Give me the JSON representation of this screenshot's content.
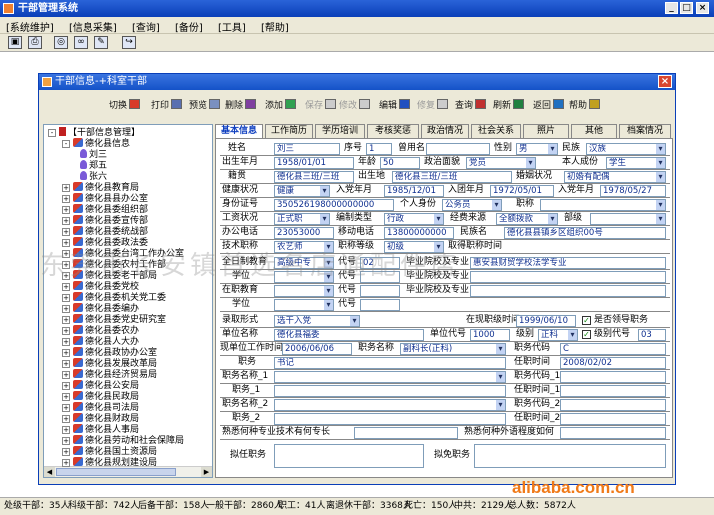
{
  "app": {
    "title": "干部管理系统"
  },
  "menu": [
    "[系统维护]",
    "[信息采集]",
    "[查询]",
    "[备份]",
    "[工具]",
    "[帮助]"
  ],
  "dialog": {
    "title": "干部信息-+科室干部",
    "actions": [
      {
        "label": "切换",
        "icon": "arrow-right-icon",
        "disabled": false
      },
      {
        "label": "打印",
        "icon": "printer-icon",
        "disabled": false
      },
      {
        "label": "预览",
        "icon": "preview-icon",
        "disabled": false
      },
      {
        "label": "删除",
        "icon": "delete-icon",
        "disabled": false
      },
      {
        "label": "添加",
        "icon": "add-icon",
        "disabled": false
      },
      {
        "label": "保存",
        "icon": "save-icon",
        "disabled": true
      },
      {
        "label": "修改",
        "icon": "modify-icon",
        "disabled": true
      },
      {
        "label": "编辑",
        "icon": "edit-icon",
        "disabled": false
      },
      {
        "label": "修复",
        "icon": "repair-icon",
        "disabled": true
      },
      {
        "label": "查询",
        "icon": "search-icon",
        "disabled": false
      },
      {
        "label": "刷新",
        "icon": "refresh-icon",
        "disabled": false
      },
      {
        "label": "返回",
        "icon": "return-icon",
        "disabled": false
      },
      {
        "label": "帮助",
        "icon": "help-icon",
        "disabled": false
      }
    ]
  },
  "tree": {
    "root": "【干部信息管理】",
    "expanded": "德化县信息",
    "people": [
      "刘三",
      "郑五",
      "张六"
    ],
    "groups": [
      "德化县教育局",
      "德化县县办公室",
      "德化县委组织部",
      "德化县委宣传部",
      "德化县委统战部",
      "德化县委政法委",
      "德化县委台湾工作办公室",
      "德化县委农村工作部",
      "德化县委老干部局",
      "德化县委党校",
      "德化县委机关党工委",
      "德化县委编办",
      "德化县委党史研究室",
      "德化县委农办",
      "德化县人大办",
      "德化县政协办公室",
      "德化县发展改革局",
      "德化县经济贸易局",
      "德化县公安局",
      "德化县民政局",
      "德化县司法局",
      "德化县财政局",
      "德化县人事局",
      "德化县劳动和社会保障局",
      "德化县国土资源局",
      "德化县规划建设局",
      "德化县交通局"
    ]
  },
  "tabs": [
    "基本信息",
    "工作简历",
    "学历培训",
    "考核奖惩",
    "政治情况",
    "社会关系",
    "照片",
    "其他",
    "档案情况"
  ],
  "form": {
    "name_label": "姓名",
    "name": "刘三",
    "seq_label": "序号",
    "seq": "1",
    "alias_label": "曾用名",
    "alias": "",
    "gender_label": "性别",
    "gender": "男",
    "ethnic_label": "民族",
    "ethnic": "汉族",
    "birth_label": "出生年月",
    "birth": "1958/01/01",
    "age_label": "年龄",
    "age": "50",
    "political_label": "政治面貌",
    "political": "党员",
    "identity_label": "本人成份",
    "identity": "学生",
    "native_label": "籍贯",
    "native": "德化县三班/三班",
    "birthplace_label": "出生地",
    "birthplace": "德化县三班/三班",
    "marital_label": "婚姻状况",
    "marital": "初婚有配偶",
    "health_label": "健康状况",
    "health": "健康",
    "party_date_label": "入党年月",
    "party_date": "1985/12/01",
    "work_date_label": "入团年月",
    "work_date": "1972/05/01",
    "join_date_label": "入党年月",
    "join_date": "1978/05/27",
    "idcard_label": "身份证号",
    "idcard": "350526198000000000",
    "status_label": "个人身份",
    "status": "公务员",
    "title_label": "职称",
    "title": "",
    "worktype_label": "工资状况",
    "worktype": "正式职",
    "salary_label": "编制类型",
    "salary": "行政",
    "treatment_label": "经费来源",
    "treatment": "全额拨款",
    "dept_label": "部级",
    "dept": "",
    "office_phone_label": "办公电话",
    "office_phone": "23053000",
    "mobile_label": "移动电话",
    "mobile": "13800000000",
    "email_label": "民族名",
    "email": "德化县县镇乡区组织00号",
    "tech_label": "技术职称",
    "tech": "农艺师",
    "tech_level_label": "职称等级",
    "tech_level": "初级",
    "tech_date_label": "取得职称时间",
    "fulltime_label": "全日制教育",
    "fulltime": "高级中专",
    "code_label": "代号",
    "code": "02",
    "school_label": "毕业院校及专业",
    "school": "惠安县财贸学校法学专业",
    "onjob_label": "在职教育",
    "degree_label": "学位",
    "onjob_degree_label": "学位",
    "school2_label": "毕业院校及专业",
    "school3_label": "毕业院校及专业",
    "code2_label": "代号",
    "code3_label": "代号",
    "code4_label": "代号",
    "appoint_method_label": "录取形式",
    "appoint_method": "选干入党",
    "appoint_date_label": "在现职级时间",
    "appoint_date": "1999/06/10",
    "fullmark_label": "是否领导职务",
    "unit_label": "单位名称",
    "unit": "德化县福委",
    "unit_code_label": "单位代号",
    "unit_code": "1000",
    "rank_label": "级别",
    "rank": "正科",
    "rank_code_label": "级别代号",
    "rank_code": "03",
    "current_date_label": "现单位工作时间",
    "current_date": "2006/06/06",
    "post_name_label": "职务名称",
    "post_name": "副科长(正科)",
    "post_code_label": "职务代码",
    "post_code": "C",
    "duty_label": "职务",
    "duty": "书记",
    "duty_date_label": "任职时间",
    "duty_date": "2008/02/02",
    "post2_label": "职务名称_1",
    "post2_code_label": "职务代码_1",
    "duty2_label": "职务_1",
    "duty2_date_label": "任职时间_1",
    "post3_label": "职务名称_2",
    "post3_code_label": "职务代码_2",
    "duty3_label": "职务_2",
    "duty3_date_label": "任职时间_2",
    "specialty_label": "熟悉何种专业技术有何专长",
    "language_label": "熟悉何种外语程度如何",
    "appoint_label": "拟任职务",
    "remove_label": "拟免职务"
  },
  "status": [
    "处级干部：35人",
    "科级干部：742人",
    "后备干部：158人",
    "一般干部：2860人",
    "职工：41人",
    "离退休干部：3368人",
    "死亡：150人",
    "中共：2129人",
    "总人数：5872人"
  ],
  "watermark": "东莞市长安镇首选名店通配件店",
  "alibaba": "alibaba.com.cn"
}
